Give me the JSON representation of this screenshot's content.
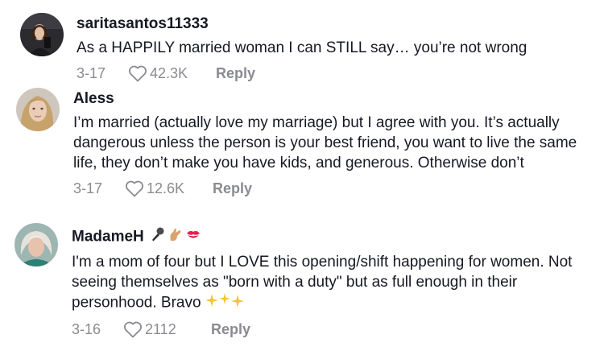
{
  "comments": [
    {
      "username": "saritasantos11333",
      "text": "As a HAPPILY married woman I can STILL say… you’re not wrong",
      "date": "3-17",
      "likes": "42.3K",
      "reply_label": "Reply",
      "avatar_icon": "user-avatar-photo"
    },
    {
      "username": "Aless",
      "text": "I’m married (actually love my marriage) but I agree with you. It’s actually dangerous unless the person is your best friend, you want to live the same life, they don’t make you have kids, and generous. Otherwise don’t",
      "date": "3-17",
      "likes": "12.6K",
      "reply_label": "Reply",
      "avatar_icon": "user-avatar-photo"
    },
    {
      "username": "MadameH",
      "username_emojis": [
        "microphone",
        "pinching-hand",
        "kiss-mark"
      ],
      "text": "I'm a mom of four but I LOVE this opening/shift happening for women. Not seeing themselves as \"born with a duty\" but as full enough in their personhood. Bravo",
      "text_emojis": [
        "sparkles",
        "sparkles",
        "sparkles"
      ],
      "date": "3-16",
      "likes": "2112",
      "reply_label": "Reply",
      "avatar_icon": "user-avatar-photo"
    }
  ],
  "colors": {
    "text": "#161823",
    "muted": "#8a8b91",
    "background": "#ffffff"
  }
}
